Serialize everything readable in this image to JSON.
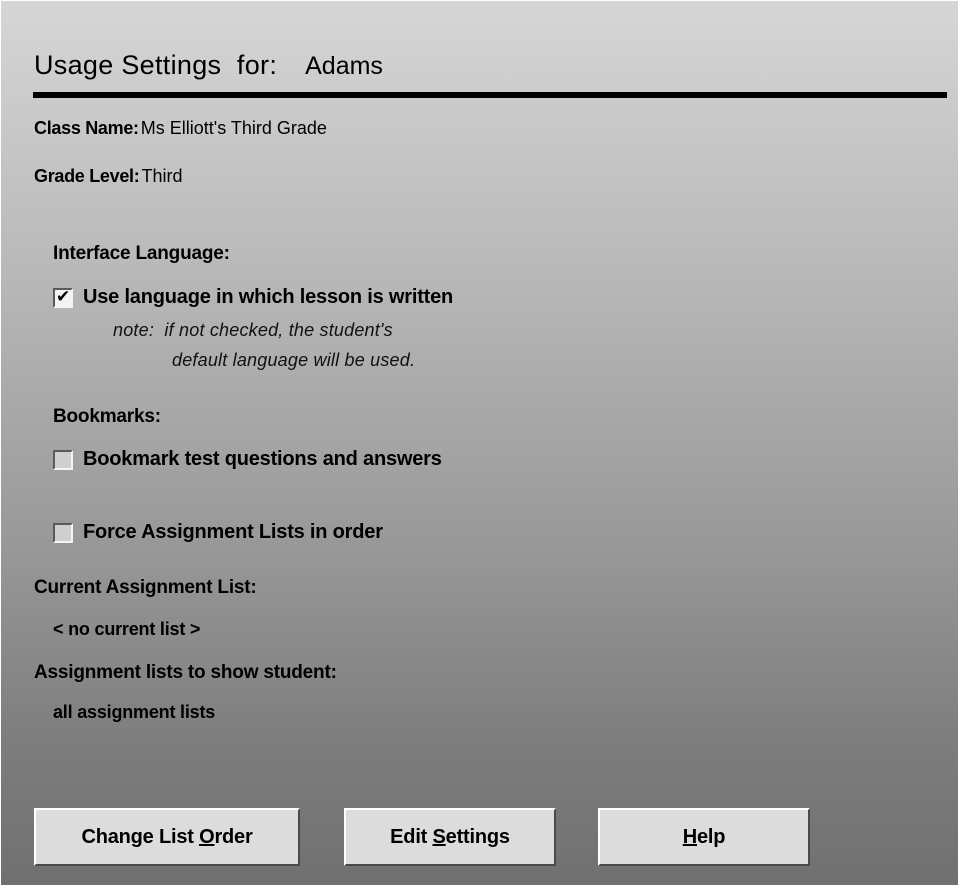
{
  "header": {
    "title_label": "Usage Settings  for:",
    "student_name": "Adams"
  },
  "class_info": {
    "class_name_label": "Class Name:",
    "class_name_value": "Ms Elliott's Third Grade",
    "grade_level_label": "Grade Level:",
    "grade_level_value": "Third"
  },
  "interface_language": {
    "heading": "Interface Language:",
    "checkbox_label": "Use language in which lesson is written",
    "checked": true,
    "note_line1": "note:  if not checked, the student's",
    "note_line2": "default language will be used."
  },
  "bookmarks": {
    "heading": "Bookmarks:",
    "checkbox_label": "Bookmark test questions and answers",
    "checked": false
  },
  "force_order": {
    "checkbox_label": "Force Assignment Lists in order",
    "checked": false
  },
  "current_list": {
    "label": "Current Assignment List:",
    "value": "< no current list >"
  },
  "lists_to_show": {
    "label": "Assignment lists to show student:",
    "value": "all assignment lists"
  },
  "buttons": {
    "change_order": {
      "pre": "Change List ",
      "mnemonic": "O",
      "post": "rder"
    },
    "edit_settings": {
      "pre": "Edit ",
      "mnemonic": "S",
      "post": "ettings"
    },
    "help": {
      "pre": "",
      "mnemonic": "H",
      "post": "elp"
    }
  },
  "icons": {
    "checkmark": "✔"
  }
}
